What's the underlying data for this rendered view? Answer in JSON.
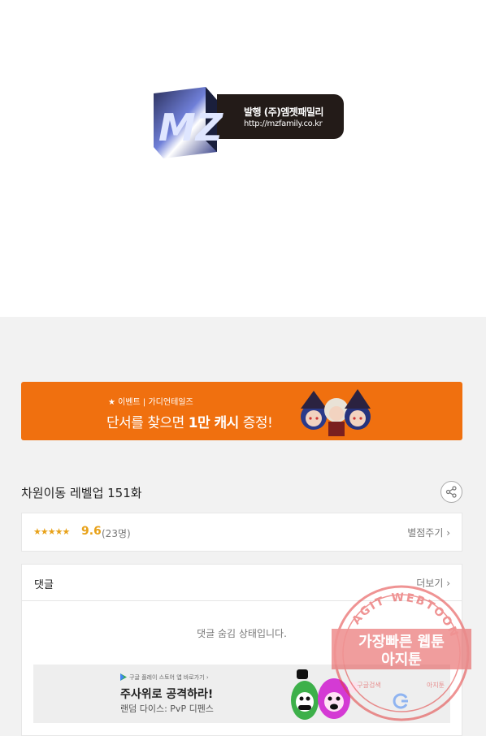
{
  "publisher": {
    "line1": "발행 (주)엠젯패밀리",
    "line2": "http://mzfamily.co.kr",
    "logo_letters": "MZ"
  },
  "event_banner": {
    "subtitle": "★ 이벤트 | 가디언테일즈",
    "headline_prefix": "단서를 찾으면 ",
    "headline_bold": "1만 캐시",
    "headline_suffix": " 증정!"
  },
  "episode": {
    "title": "차원이동 레벨업 151화",
    "share_icon": "share-icon"
  },
  "rating": {
    "stars": "★★★★★",
    "score": "9.6",
    "count": "(23명)",
    "rate_link": "별점주기 ›"
  },
  "comments": {
    "title": "댓글",
    "more_link": "더보기 ›",
    "hidden_message": "댓글 숨김 상태입니다."
  },
  "ad": {
    "store_text": "구글 플레이 스토어 앱 바로가기 ›",
    "title": "주사위로 공격하라!",
    "description": "랜덤 다이스: PvP 디펜스"
  },
  "watermark": {
    "ring_text": "AGIT WEBTOON",
    "line1": "가장빠른 웹툰",
    "line2": "아지툰",
    "footer_left": "구글검색",
    "footer_right": "아지툰"
  },
  "colors": {
    "banner_orange": "#f0700f",
    "star_gold": "#e8a21a",
    "watermark_red": "#e23b3b"
  }
}
